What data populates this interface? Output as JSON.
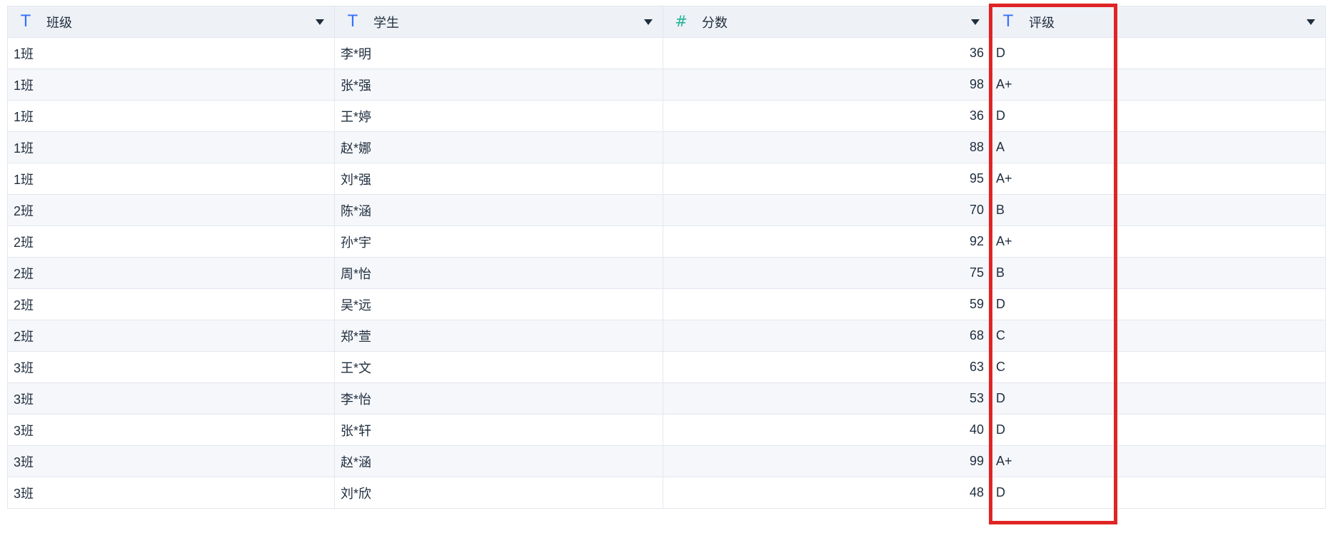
{
  "columns": [
    {
      "label": "班级",
      "type_icon": "text-field-icon"
    },
    {
      "label": "学生",
      "type_icon": "text-field-icon"
    },
    {
      "label": "分数",
      "type_icon": "number-field-icon"
    },
    {
      "label": "评级",
      "type_icon": "text-field-icon"
    }
  ],
  "rows": [
    {
      "class": "1班",
      "student": "李*明",
      "score": "36",
      "grade": "D"
    },
    {
      "class": "1班",
      "student": "张*强",
      "score": "98",
      "grade": "A+"
    },
    {
      "class": "1班",
      "student": "王*婷",
      "score": "36",
      "grade": "D"
    },
    {
      "class": "1班",
      "student": "赵*娜",
      "score": "88",
      "grade": "A"
    },
    {
      "class": "1班",
      "student": "刘*强",
      "score": "95",
      "grade": "A+"
    },
    {
      "class": "2班",
      "student": "陈*涵",
      "score": "70",
      "grade": "B"
    },
    {
      "class": "2班",
      "student": "孙*宇",
      "score": "92",
      "grade": "A+"
    },
    {
      "class": "2班",
      "student": "周*怡",
      "score": "75",
      "grade": "B"
    },
    {
      "class": "2班",
      "student": "吴*远",
      "score": "59",
      "grade": "D"
    },
    {
      "class": "2班",
      "student": "郑*萱",
      "score": "68",
      "grade": "C"
    },
    {
      "class": "3班",
      "student": "王*文",
      "score": "63",
      "grade": "C"
    },
    {
      "class": "3班",
      "student": "李*怡",
      "score": "53",
      "grade": "D"
    },
    {
      "class": "3班",
      "student": "张*轩",
      "score": "40",
      "grade": "D"
    },
    {
      "class": "3班",
      "student": "赵*涵",
      "score": "99",
      "grade": "A+"
    },
    {
      "class": "3班",
      "student": "刘*欣",
      "score": "48",
      "grade": "D"
    }
  ],
  "colors": {
    "text_icon": "#3370ff",
    "number_icon": "#29b39b",
    "header_bg": "#eef1f6",
    "stripe_bg": "#f5f7fa",
    "highlight_border": "#e02424"
  }
}
